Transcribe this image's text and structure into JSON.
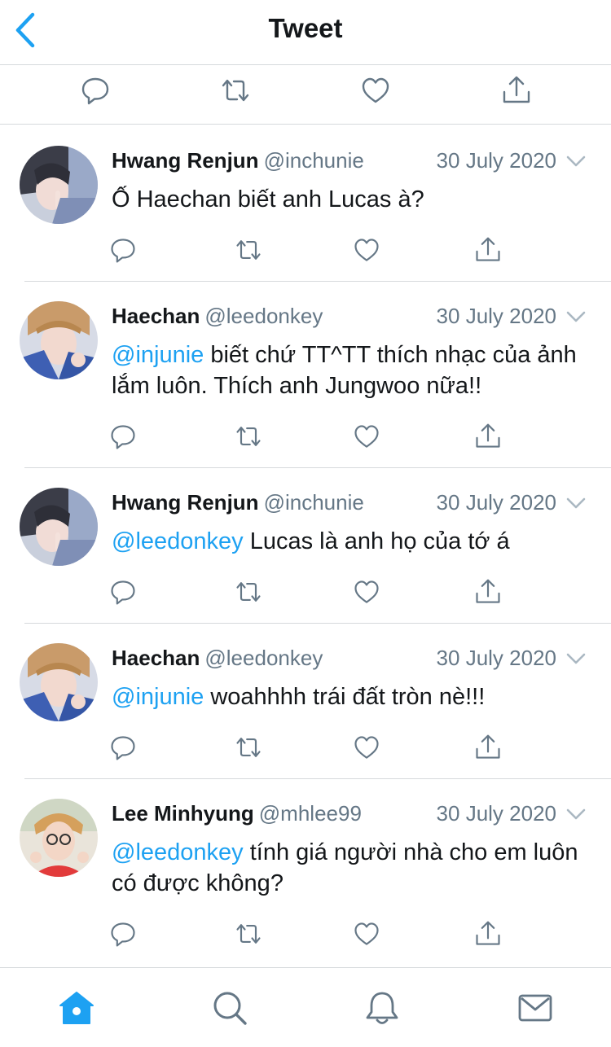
{
  "nav": {
    "title": "Tweet",
    "back_icon": "chevron-left-icon"
  },
  "colors": {
    "accent": "#1da1f2",
    "text": "#14171a",
    "muted": "#657786",
    "divider": "#d6d9dc",
    "icon_gray": "#657786"
  },
  "tweets": [
    {
      "name": "Hwang Renjun",
      "handle": "@inchunie",
      "date": "30 July 2020",
      "mention": "",
      "text": "Ố Haechan biết anh Lucas à?",
      "avatar": "avatar-renjun"
    },
    {
      "name": "Haechan",
      "handle": "@leedonkey",
      "date": "30 July 2020",
      "mention": "@injunie",
      "text": " biết chứ TT^TT thích nhạc của ảnh lắm luôn. Thích anh Jungwoo nữa!!",
      "avatar": "avatar-haechan"
    },
    {
      "name": "Hwang Renjun",
      "handle": "@inchunie",
      "date": "30 July 2020",
      "mention": "@leedonkey",
      "text": " Lucas là anh họ của tớ á",
      "avatar": "avatar-renjun"
    },
    {
      "name": "Haechan",
      "handle": "@leedonkey",
      "date": "30 July 2020",
      "mention": "@injunie",
      "text": " woahhhh trái đất tròn nè!!!",
      "avatar": "avatar-haechan"
    },
    {
      "name": "Lee Minhyung",
      "handle": "@mhlee99",
      "date": "30 July 2020",
      "mention": "@leedonkey",
      "text": " tính giá người nhà cho em luôn có được không?",
      "avatar": "avatar-minhyung"
    }
  ],
  "tabbar": {
    "items": [
      "home-icon",
      "search-icon",
      "notifications-icon",
      "messages-icon"
    ],
    "active": "home-icon"
  }
}
